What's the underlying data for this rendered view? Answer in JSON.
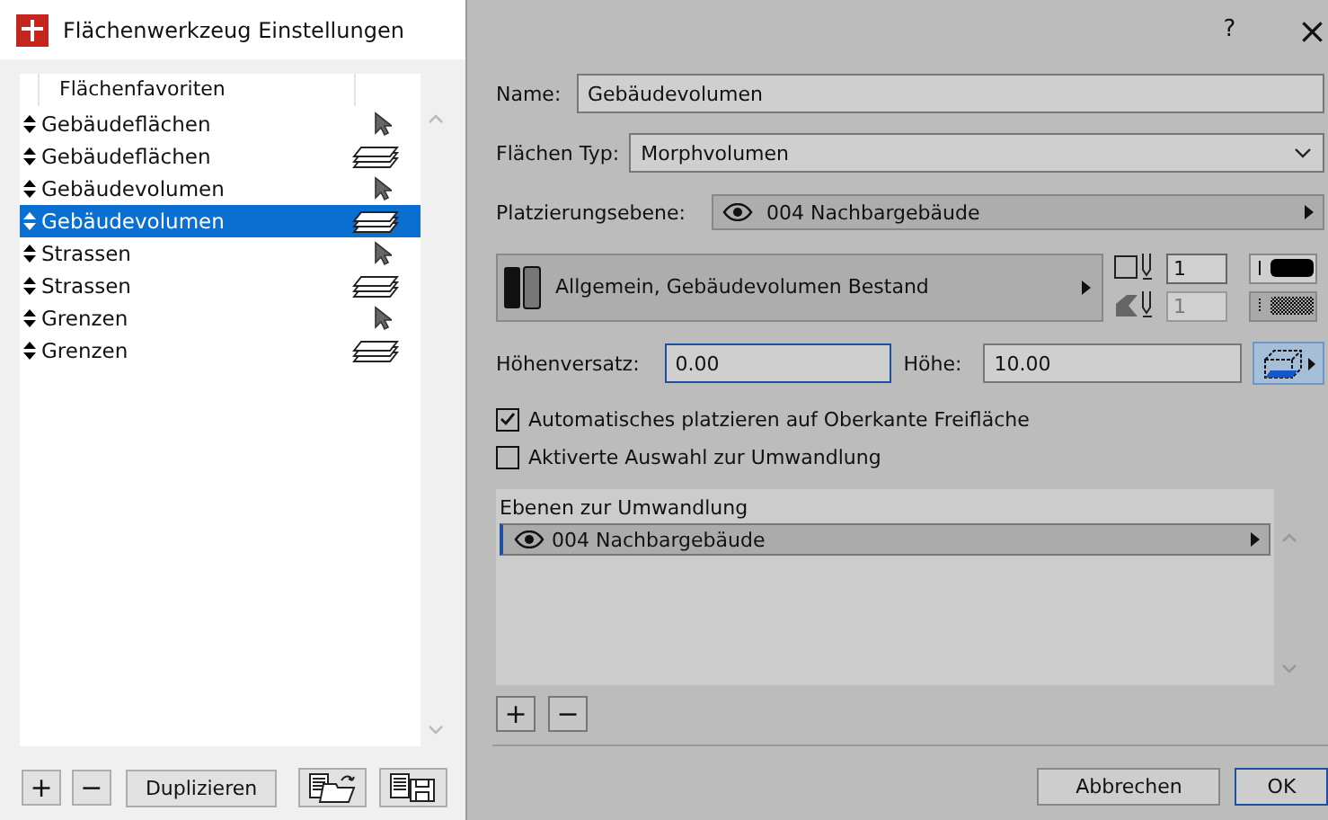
{
  "window": {
    "title": "Flächenwerkzeug Einstellungen",
    "help": "?",
    "close": "×"
  },
  "favorites": {
    "header": "Flächenfavoriten",
    "items": [
      {
        "label": "Gebäudeflächen",
        "kind": "pointer",
        "selected": false
      },
      {
        "label": "Gebäudeflächen",
        "kind": "stack",
        "selected": false
      },
      {
        "label": "Gebäudevolumen",
        "kind": "pointer",
        "selected": false
      },
      {
        "label": "Gebäudevolumen",
        "kind": "stack",
        "selected": true
      },
      {
        "label": "Strassen",
        "kind": "pointer",
        "selected": false
      },
      {
        "label": "Strassen",
        "kind": "stack",
        "selected": false
      },
      {
        "label": "Grenzen",
        "kind": "pointer",
        "selected": false
      },
      {
        "label": "Grenzen",
        "kind": "stack",
        "selected": false
      }
    ],
    "buttons": {
      "add": "+",
      "remove": "−",
      "duplicate": "Duplizieren"
    }
  },
  "name": {
    "label": "Name:",
    "value": "Gebäudevolumen"
  },
  "area_type": {
    "label": "Flächen Typ:",
    "value": "Morphvolumen"
  },
  "placement_layer": {
    "label": "Platzierungsebene:",
    "value": "004 Nachbargebäude"
  },
  "surface": {
    "value": "Allgemein, Gebäudevolumen Bestand"
  },
  "pens": [
    {
      "value": "1",
      "disabled": false
    },
    {
      "value": "1",
      "disabled": true
    }
  ],
  "offset": {
    "label": "Höhenversatz:",
    "value": "0.00"
  },
  "height": {
    "label": "Höhe:",
    "value": "10.00"
  },
  "checkboxes": [
    {
      "label": "Automatisches platzieren auf Oberkante Freifläche",
      "checked": true
    },
    {
      "label": "Aktiverte Auswahl zur Umwandlung",
      "checked": false
    }
  ],
  "conversion_layers": {
    "header": "Ebenen zur Umwandlung",
    "items": [
      "004 Nachbargebäude"
    ],
    "add": "+",
    "remove": "−"
  },
  "footer": {
    "cancel": "Abbrechen",
    "ok": "OK"
  }
}
